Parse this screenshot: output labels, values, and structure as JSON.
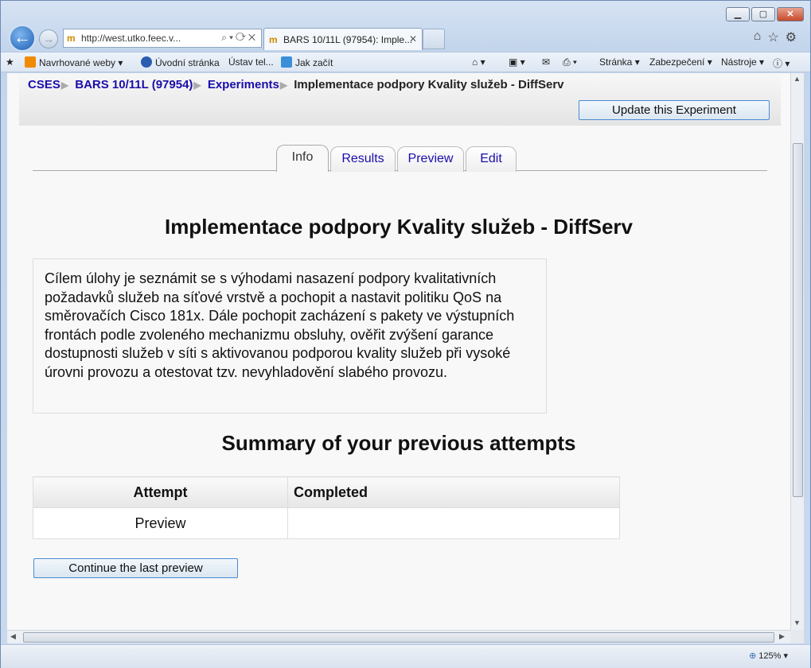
{
  "browser": {
    "address_url": "http://west.utko.feec.v...",
    "tab_title": "BARS 10/11L (97954): Imple...",
    "favorites": [
      "Navrhované weby",
      "Úvodní stránka",
      "Ústav tel...",
      "Jak začít"
    ],
    "commands": [
      "Stránka",
      "Zabezpečení",
      "Nástroje"
    ],
    "zoom": "125%"
  },
  "breadcrumb": {
    "items": [
      "CSES",
      "BARS 10/11L (97954)",
      "Experiments"
    ],
    "separator": "▶",
    "current": "Implementace podpory Kvality služeb - DiffServ"
  },
  "update_button": "Update this Experiment",
  "tabs": [
    "Info",
    "Results",
    "Preview",
    "Edit"
  ],
  "page_title": "Implementace podpory Kvality služeb - DiffServ",
  "intro_text": "Cílem úlohy je seznámit se s výhodami nasazení podpory kvalitativních požadavků služeb na síťové vrstvě a pochopit a nastavit politiku QoS na směrovačích Cisco 181x. Dále pochopit zacházení s pakety ve výstupních frontách podle zvoleného mechanizmu obsluhy, ověřit zvýšení garance dostupnosti služeb v síti s aktivovanou podporou kvality služeb při vysoké úrovni provozu a otestovat tzv. nevyhladovění slabého provozu.",
  "summary_title": "Summary of your previous attempts",
  "attempts_table": {
    "headers": [
      "Attempt",
      "Completed"
    ],
    "rows": [
      [
        "Preview",
        ""
      ]
    ]
  },
  "continue_button": "Continue the last preview"
}
